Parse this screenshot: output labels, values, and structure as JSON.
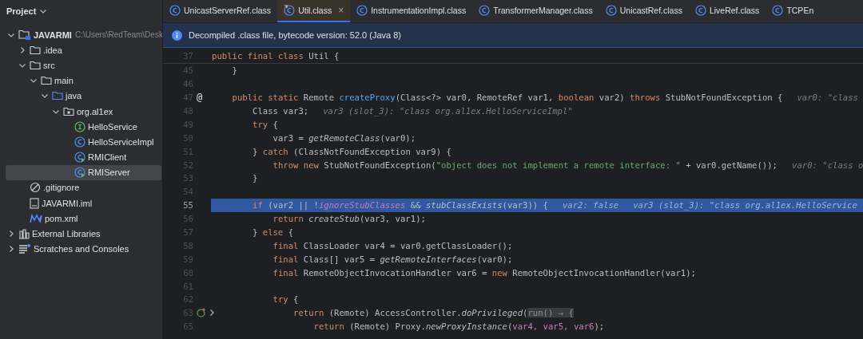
{
  "sidebar": {
    "title": "Project",
    "tree": [
      {
        "label": "JAVARMI",
        "detail": "C:\\Users\\RedTeam\\Desk",
        "kind": "module",
        "expanded": true,
        "selected": false,
        "children": [
          {
            "label": ".idea",
            "kind": "folder",
            "expanded": false,
            "selected": false
          },
          {
            "label": "src",
            "kind": "folder",
            "expanded": true,
            "selected": false,
            "children": [
              {
                "label": "main",
                "kind": "folder",
                "expanded": true,
                "selected": false,
                "children": [
                  {
                    "label": "java",
                    "kind": "source-folder",
                    "expanded": true,
                    "selected": false,
                    "children": [
                      {
                        "label": "org.al1ex",
                        "kind": "package",
                        "expanded": true,
                        "selected": false,
                        "children": [
                          {
                            "label": "HelloService",
                            "kind": "interface",
                            "selected": false
                          },
                          {
                            "label": "HelloServiceImpl",
                            "kind": "class",
                            "selected": false
                          },
                          {
                            "label": "RMIClient",
                            "kind": "runnable-class",
                            "selected": false
                          },
                          {
                            "label": "RMIServer",
                            "kind": "runnable-class",
                            "selected": true
                          }
                        ]
                      }
                    ]
                  }
                ]
              }
            ]
          },
          {
            "label": ".gitignore",
            "kind": "ignore",
            "selected": false
          },
          {
            "label": "JAVARMI.iml",
            "kind": "file",
            "selected": false
          },
          {
            "label": "pom.xml",
            "kind": "maven",
            "selected": false
          }
        ]
      },
      {
        "label": "External Libraries",
        "kind": "libraries",
        "expanded": false,
        "selected": false
      },
      {
        "label": "Scratches and Consoles",
        "kind": "scratches",
        "expanded": false,
        "selected": false
      }
    ]
  },
  "tabs": [
    {
      "label": "UnicastServerRef.class",
      "kind": "class",
      "selected": false
    },
    {
      "label": "Util.class",
      "kind": "refresh-class",
      "selected": true,
      "close": "×"
    },
    {
      "label": "InstrumentationImpl.class",
      "kind": "class",
      "selected": false
    },
    {
      "label": "TransformerManager.class",
      "kind": "class",
      "selected": false
    },
    {
      "label": "UnicastRef.class",
      "kind": "class",
      "selected": false
    },
    {
      "label": "LiveRef.class",
      "kind": "class",
      "selected": false
    },
    {
      "label": "TCPEn",
      "kind": "class",
      "selected": false
    }
  ],
  "banner": {
    "text": "Decompiled .class file, bytecode version: 52.0 (Java 8)"
  },
  "editor": {
    "lines": [
      {
        "number": "37",
        "selected": false,
        "sticky": true,
        "tokens": [
          {
            "kind": "kw",
            "text": "public final class "
          },
          {
            "kind": "plain",
            "text": "Util {"
          }
        ]
      },
      {
        "number": "45",
        "selected": false,
        "tokens": [
          {
            "kind": "plain",
            "text": "    }"
          }
        ]
      },
      {
        "number": "46",
        "selected": false
      },
      {
        "number": "47",
        "selected": false,
        "gutter": {
          "kind": "glyph",
          "text": "@"
        },
        "tokens": [
          {
            "kind": "kw",
            "text": "    public static "
          },
          {
            "kind": "plain",
            "text": "Remote "
          },
          {
            "kind": "decl",
            "text": "createProxy"
          },
          {
            "kind": "plain",
            "text": "(Class<?> var0, RemoteRef var1, "
          },
          {
            "kind": "kw",
            "text": "boolean "
          },
          {
            "kind": "plain",
            "text": "var2) "
          },
          {
            "kind": "kw",
            "text": "throws "
          },
          {
            "kind": "plain",
            "text": "StubNotFoundException {"
          }
        ],
        "hints": [
          "var0: \"class"
        ]
      },
      {
        "number": "48",
        "selected": false,
        "tokens": [
          {
            "kind": "plain",
            "text": "        Class var3;"
          }
        ],
        "hints": [
          "var3 (slot_3): \"class org.al1ex.HelloServiceImpl\""
        ]
      },
      {
        "number": "49",
        "selected": false,
        "tokens": [
          {
            "kind": "kw",
            "text": "        try "
          },
          {
            "kind": "plain",
            "text": "{"
          }
        ]
      },
      {
        "number": "50",
        "selected": false,
        "tokens": [
          {
            "kind": "plain",
            "text": "            var3 = "
          },
          {
            "kind": "call",
            "text": "getRemoteClass"
          },
          {
            "kind": "plain",
            "text": "(var0);"
          }
        ]
      },
      {
        "number": "51",
        "selected": false,
        "tokens": [
          {
            "kind": "plain",
            "text": "        } "
          },
          {
            "kind": "kw",
            "text": "catch "
          },
          {
            "kind": "plain",
            "text": "(ClassNotFoundException var9) {"
          }
        ]
      },
      {
        "number": "52",
        "selected": false,
        "tokens": [
          {
            "kind": "kw",
            "text": "            throw new "
          },
          {
            "kind": "plain",
            "text": "StubNotFoundException("
          },
          {
            "kind": "str",
            "text": "\"object does not implement a remote interface: \""
          },
          {
            "kind": "plain",
            "text": " + var0.getName());"
          }
        ],
        "hints": [
          "var0: \"class o"
        ]
      },
      {
        "number": "53",
        "selected": false,
        "tokens": [
          {
            "kind": "plain",
            "text": "        }"
          }
        ]
      },
      {
        "number": "54",
        "selected": false
      },
      {
        "number": "55",
        "selected": true,
        "tokens": [
          {
            "kind": "kw",
            "text": "        if "
          },
          {
            "kind": "plain",
            "text": "(var2 || !"
          },
          {
            "kind": "field",
            "text": "ignoreStubClasses"
          },
          {
            "kind": "plain",
            "text": " && "
          },
          {
            "kind": "call",
            "text": "stubClassExists"
          },
          {
            "kind": "plain",
            "text": "(var3)) {"
          }
        ],
        "hints": [
          "var2: false",
          "var3 (slot_3): \"class org.al1ex.HelloService"
        ]
      },
      {
        "number": "56",
        "selected": false,
        "tokens": [
          {
            "kind": "kw",
            "text": "            return "
          },
          {
            "kind": "call",
            "text": "createStub"
          },
          {
            "kind": "plain",
            "text": "(var3, var1);"
          }
        ]
      },
      {
        "number": "57",
        "selected": false,
        "tokens": [
          {
            "kind": "plain",
            "text": "        } "
          },
          {
            "kind": "kw",
            "text": "else "
          },
          {
            "kind": "plain",
            "text": "{"
          }
        ]
      },
      {
        "number": "58",
        "selected": false,
        "tokens": [
          {
            "kind": "kw",
            "text": "            final "
          },
          {
            "kind": "plain",
            "text": "ClassLoader var4 = var0.getClassLoader();"
          }
        ]
      },
      {
        "number": "59",
        "selected": false,
        "tokens": [
          {
            "kind": "kw",
            "text": "            final "
          },
          {
            "kind": "plain",
            "text": "Class[] var5 = "
          },
          {
            "kind": "call",
            "text": "getRemoteInterfaces"
          },
          {
            "kind": "plain",
            "text": "(var0);"
          }
        ]
      },
      {
        "number": "60",
        "selected": false,
        "tokens": [
          {
            "kind": "kw",
            "text": "            final "
          },
          {
            "kind": "plain",
            "text": "RemoteObjectInvocationHandler var6 = "
          },
          {
            "kind": "kw",
            "text": "new "
          },
          {
            "kind": "plain",
            "text": "RemoteObjectInvocationHandler(var1);"
          }
        ]
      },
      {
        "number": "61",
        "selected": false
      },
      {
        "number": "62",
        "selected": false,
        "tokens": [
          {
            "kind": "kw",
            "text": "            try "
          },
          {
            "kind": "plain",
            "text": "{"
          }
        ]
      },
      {
        "number": "63",
        "selected": false,
        "gutter": {
          "kind": "override-icon"
        },
        "tokens": [
          {
            "kind": "kw",
            "text": "                return "
          },
          {
            "kind": "plain",
            "text": "(Remote) AccessController."
          },
          {
            "kind": "call",
            "text": "doPrivileged"
          },
          {
            "kind": "plain",
            "text": "("
          },
          {
            "kind": "fold",
            "text": "run() → {"
          }
        ]
      },
      {
        "number": "65",
        "selected": false,
        "tokens": [
          {
            "kind": "kw",
            "text": "                    return "
          },
          {
            "kind": "plain",
            "text": "(Remote) Proxy."
          },
          {
            "kind": "call",
            "text": "newProxyInstance"
          },
          {
            "kind": "plain",
            "text": "("
          },
          {
            "kind": "captured",
            "text": "var4, var5, var6"
          },
          {
            "kind": "plain",
            "text": ");"
          }
        ]
      }
    ]
  }
}
